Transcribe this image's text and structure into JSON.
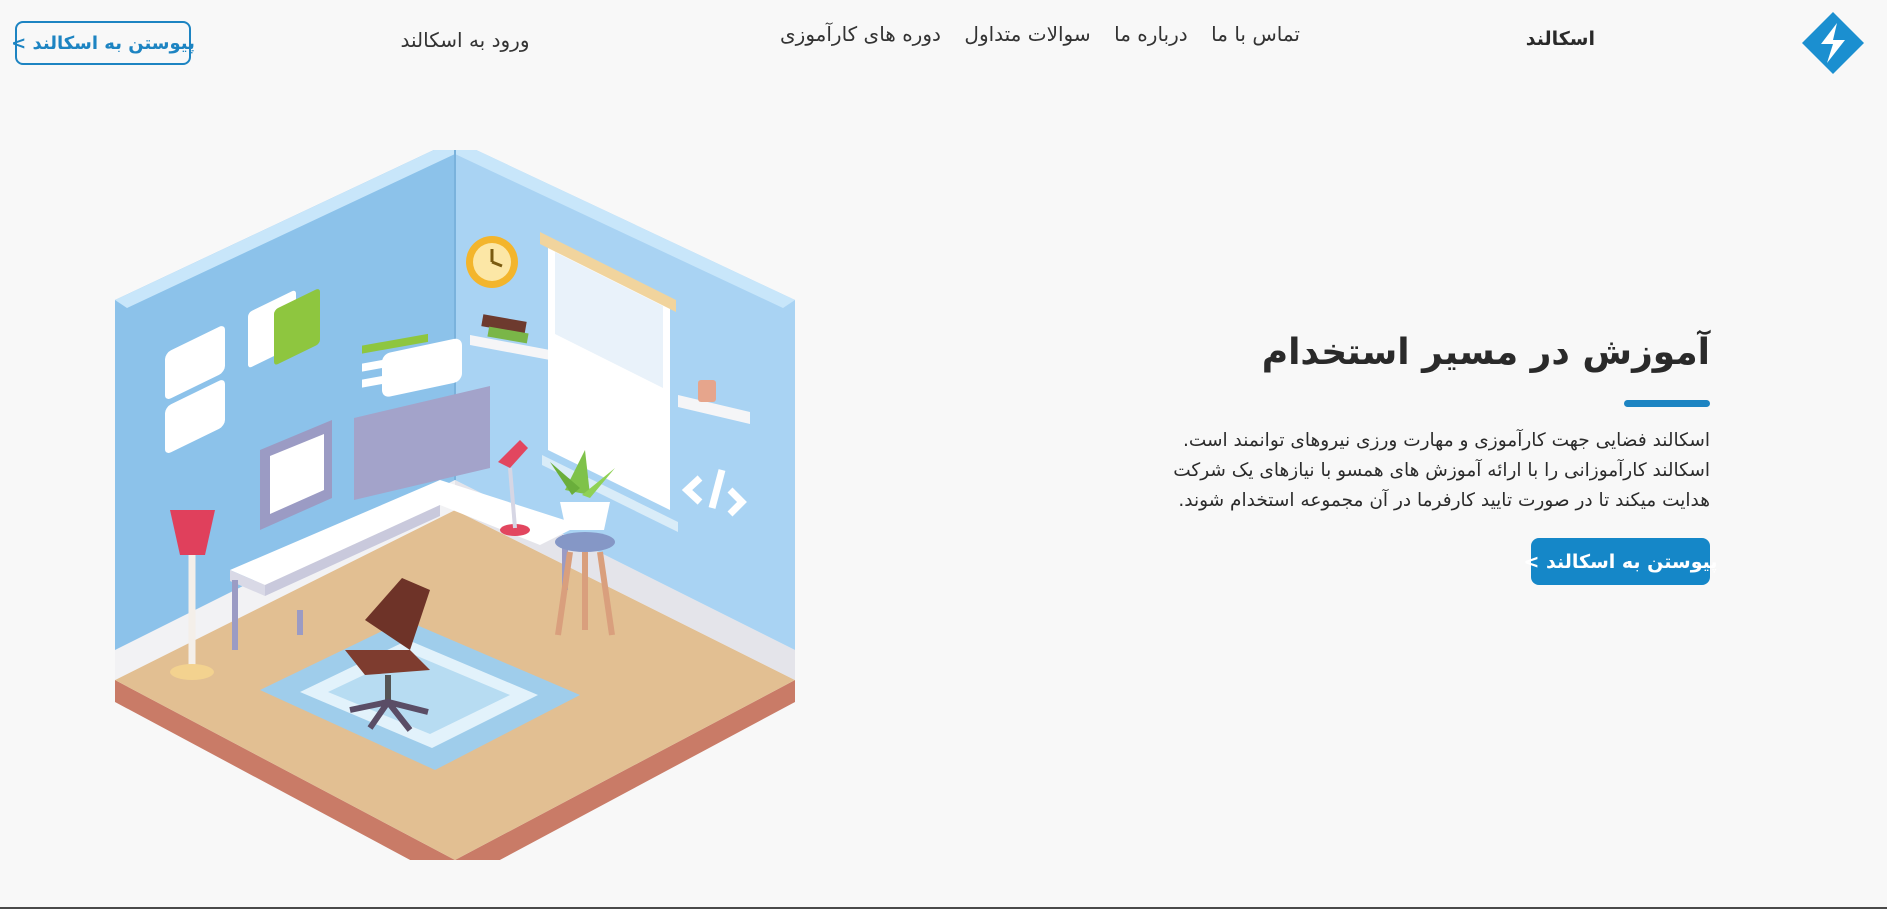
{
  "header": {
    "brand": "اسکالند",
    "nav": [
      {
        "label": "دوره های کارآموزی"
      },
      {
        "label": "سوالات متداول"
      },
      {
        "label": "درباره ما"
      },
      {
        "label": "تماس با ما"
      }
    ],
    "login": "ورود به اسکالند",
    "join_button": "پیوستن به اسکالند >"
  },
  "hero": {
    "title": "آموزش در مسیر استخدام",
    "lines": [
      "اسکالند فضایی جهت کارآموزی و مهارت ورزی نیروهای توانمند است.",
      "اسکالند کارآموزانی را با ارائه آموزش های همسو با نیازهای یک شرکت",
      "هدایت میکند تا در صورت تایید کارفرما در آن مجموعه استخدام شوند."
    ],
    "cta": "پیوستن به اسکالند >"
  },
  "colors": {
    "accent": "#1d84c2",
    "button_fill": "#1587c8",
    "background": "#f8f8f8"
  },
  "icons": {
    "logo": "skaland-logo-icon",
    "illustration": "isometric-office-room"
  }
}
